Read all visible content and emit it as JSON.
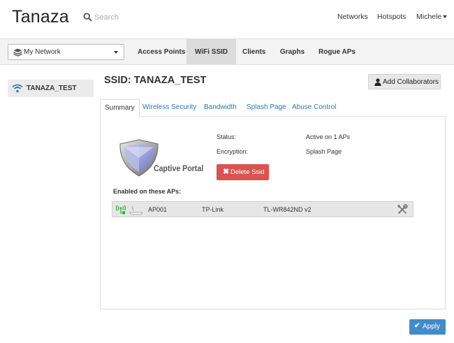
{
  "header": {
    "logo": "Tanaza",
    "search_placeholder": "Search",
    "nav": {
      "networks": "Networks",
      "hotspots": "Hotspots",
      "user": "Michele"
    }
  },
  "subnav": {
    "network_select": "My Network",
    "tabs": [
      "Access Points",
      "WiFi SSID",
      "Clients",
      "Graphs",
      "Rogue APs"
    ],
    "active_tab": "WiFi SSID"
  },
  "sidebar": {
    "items": [
      {
        "label": "TANAZA_TEST",
        "icon": "wifi-icon"
      }
    ]
  },
  "main": {
    "title": "SSID: TANAZA_TEST",
    "add_collaborators": "Add Collaborators",
    "tabs": [
      "Summary",
      "Wireless Security",
      "Bandwidth",
      "Splash Page",
      "Abuse Control"
    ],
    "active_tab": "Summary",
    "captive_portal_label": "Captive Portal",
    "status_label": "Status:",
    "status_value": "Active on 1 APs",
    "encryption_label": "Encryption:",
    "encryption_value": "Splash Page",
    "delete_button": "Delete Ssid",
    "enabled_label": "Enabled on these APs:",
    "aps": [
      {
        "name": "AP001",
        "vendor": "TP-Link",
        "model": "TL-WR842ND v2"
      }
    ],
    "apply_button": "Apply"
  },
  "colors": {
    "link": "#2a7ab0",
    "danger": "#d9534f",
    "primary": "#428bca",
    "online": "#3cb44b"
  }
}
